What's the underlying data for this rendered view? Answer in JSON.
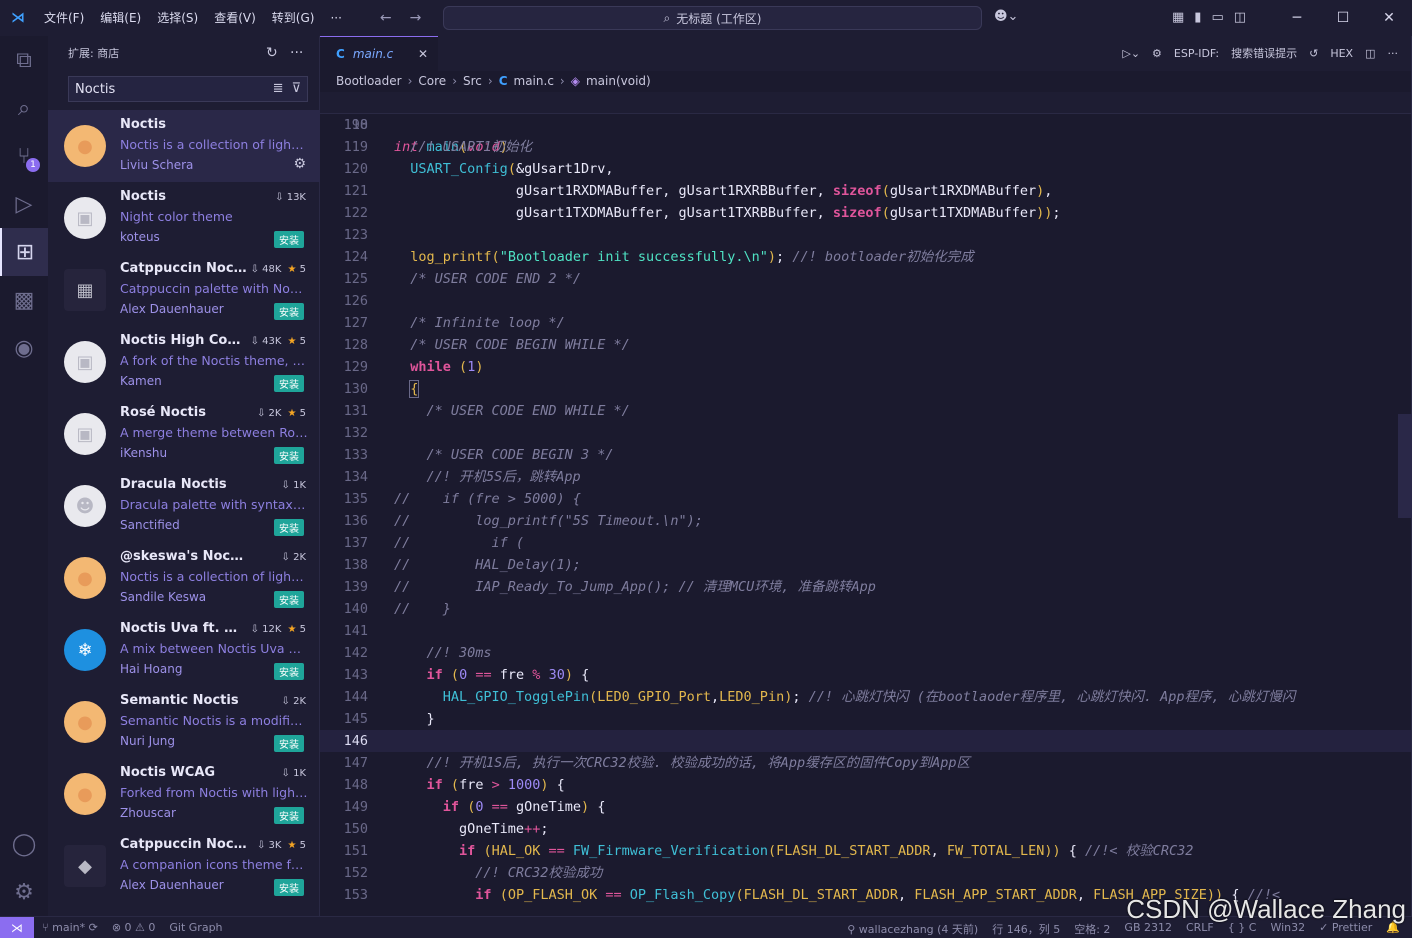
{
  "titlebar": {
    "menus": [
      "文件(F)",
      "编辑(E)",
      "选择(S)",
      "查看(V)",
      "转到(G)",
      "···"
    ],
    "search_text": "无标题 (工作区)"
  },
  "sidebar": {
    "title": "扩展: 商店",
    "search_value": "Noctis",
    "install_label": "安装",
    "extensions": [
      {
        "name": "Noctis",
        "desc": "Noctis is a collection of light &...",
        "author": "Liviu Schera",
        "downloads": "",
        "rating": "",
        "installed": true,
        "icon": "noctis-face-icon",
        "icon_color": "#f3b873"
      },
      {
        "name": "Noctis",
        "desc": "Night color theme",
        "author": "koteus",
        "downloads": "13K",
        "rating": "",
        "installed": false,
        "icon": "placeholder-icon",
        "icon_color": "#e9e9ee"
      },
      {
        "name": "Catppuccin Noctis",
        "desc": "Catppuccin palette with Noctis...",
        "author": "Alex Dauenhauer",
        "downloads": "48K",
        "rating": "5",
        "installed": false,
        "icon": "catppuccin-icon",
        "icon_color": "#26243c"
      },
      {
        "name": "Noctis High Contr...",
        "desc": "A fork of the Noctis theme, wit...",
        "author": "Kamen",
        "downloads": "43K",
        "rating": "5",
        "installed": false,
        "icon": "placeholder-icon",
        "icon_color": "#e9e9ee"
      },
      {
        "name": "Rosé Noctis",
        "desc": "A merge theme between Rosé ...",
        "author": "iKenshu",
        "downloads": "2K",
        "rating": "5",
        "installed": false,
        "icon": "placeholder-icon",
        "icon_color": "#e9e9ee"
      },
      {
        "name": "Dracula Noctis",
        "desc": "Dracula palette with syntax hig...",
        "author": "Sanctified",
        "downloads": "1K",
        "rating": "",
        "installed": false,
        "icon": "dracula-icon",
        "icon_color": "#e9e9ee"
      },
      {
        "name": "@skeswa's Noctis",
        "desc": "Noctis is a collection of light &...",
        "author": "Sandile Keswa",
        "downloads": "2K",
        "rating": "",
        "installed": false,
        "icon": "noctis-face-icon",
        "icon_color": "#f3b873"
      },
      {
        "name": "Noctis Uva ft. Wi...",
        "desc": "A mix between Noctis Uva and...",
        "author": "Hai Hoang",
        "downloads": "12K",
        "rating": "5",
        "installed": false,
        "icon": "snowflake-icon",
        "icon_color": "#1e90e0"
      },
      {
        "name": "Semantic Noctis",
        "desc": "Semantic Noctis is a modified ...",
        "author": "Nuri Jung",
        "downloads": "2K",
        "rating": "",
        "installed": false,
        "icon": "noctis-face-icon",
        "icon_color": "#f3b873"
      },
      {
        "name": "Noctis WCAG",
        "desc": "Forked from Noctis with light ...",
        "author": "Zhouscar",
        "downloads": "1K",
        "rating": "",
        "installed": false,
        "icon": "noctis-face-icon",
        "icon_color": "#f3b873"
      },
      {
        "name": "Catppuccin Noctis ...",
        "desc": "A companion icons theme for ...",
        "author": "Alex Dauenhauer",
        "downloads": "3K",
        "rating": "5",
        "installed": false,
        "icon": "shapes-icon",
        "icon_color": "#26243c"
      }
    ]
  },
  "editor": {
    "tab_label": "main.c",
    "tab_actions": [
      "ESP-IDF:",
      "搜索错误提示",
      "HEX"
    ],
    "breadcrumb": [
      "Bootloader",
      "Core",
      "Src",
      "main.c",
      "main(void)"
    ],
    "sticky": {
      "ln": "90",
      "text": "int main(void)"
    },
    "current_line": "146"
  },
  "statusbar": {
    "branch": "main*",
    "problems": "⊗ 0 ⚠ 0",
    "git_graph": "Git Graph",
    "author": "wallacezhang (4 天前)",
    "position": "行 146，列 5",
    "spaces": "空格: 2",
    "encoding": "GB 2312",
    "eol": "CRLF",
    "lang": "{ } C",
    "platform": "Win32",
    "prettier": "✓ Prettier"
  },
  "watermark": "CSDN @Wallace Zhang"
}
